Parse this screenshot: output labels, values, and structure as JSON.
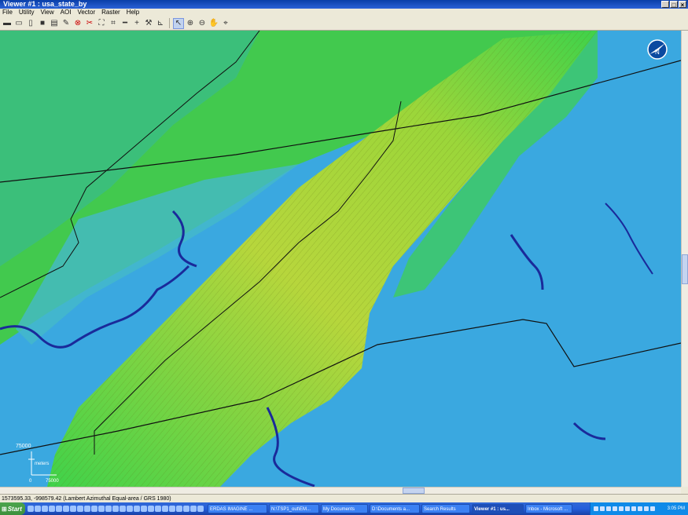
{
  "window": {
    "title": "Viewer #1 : usa_state_by",
    "controls": {
      "minimize": "_",
      "maximize": "□",
      "close": "×"
    }
  },
  "menu": [
    "File",
    "Utility",
    "View",
    "AOI",
    "Vector",
    "Raster",
    "Help"
  ],
  "toolbar": {
    "icons": [
      "open-folder-icon",
      "open-layer-icon",
      "close-layer-icon",
      "save-icon",
      "print-icon",
      "clear-icon",
      "stop-icon",
      "delete-icon",
      "fit-to-frame-icon",
      "zoom-box-icon",
      "minus-icon",
      "crosshair-icon",
      "hammer-icon",
      "graph-icon",
      "select-arrow-icon",
      "zoom-in-icon",
      "zoom-out-icon",
      "pan-hand-icon",
      "inquire-icon"
    ],
    "active": "select-arrow-icon"
  },
  "map": {
    "north_arrow_label": "N",
    "scale_bar": {
      "top_label": "75000",
      "units_label": "meters",
      "bottom_zero": "0",
      "bottom_max": "75000"
    },
    "colors": {
      "lowland": "#3aa8e0",
      "water": "#1a2a9a",
      "mid": "#3fd24a",
      "high": "#c8d63a",
      "boundary": "#101010"
    }
  },
  "status": {
    "text": "1573595.33, -998579.42  (Lambert Azimuthal Equal-area / GRS 1980)"
  },
  "taskbar": {
    "start_label": "Start",
    "tasks": [
      "ERDAS IMAGINE ...",
      "N:\\TSP1_out\\EM...",
      "My Documents",
      "D:\\Documents a...",
      "Search Results",
      "Viewer #1 : us...",
      "Inbox - Microsoft ..."
    ],
    "active_task": "Viewer #1 : us...",
    "clock": "3:05 PM"
  }
}
